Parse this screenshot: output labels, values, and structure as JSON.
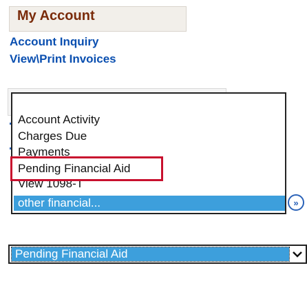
{
  "header": {
    "title": "My Account"
  },
  "links": [
    {
      "label": "Account Inquiry"
    },
    {
      "label": "View\\Print Invoices"
    }
  ],
  "listbox": {
    "items": [
      "Account Activity",
      "Charges Due",
      "Payments",
      "Pending Financial Aid",
      "View 1098-T"
    ],
    "selected_item": "other financial...",
    "highlighted_item": "Pending Financial Aid"
  },
  "go_button": {
    "icon": "double-chevron-right-icon",
    "glyph": "»"
  },
  "select": {
    "selected_value": "Pending Financial Aid",
    "arrow_icon": "chevron-down-icon"
  },
  "colors": {
    "header_title": "#7a2b0a",
    "link": "#0a4fb0",
    "selection": "#3d9fdc",
    "highlight_border": "#c8102e"
  }
}
